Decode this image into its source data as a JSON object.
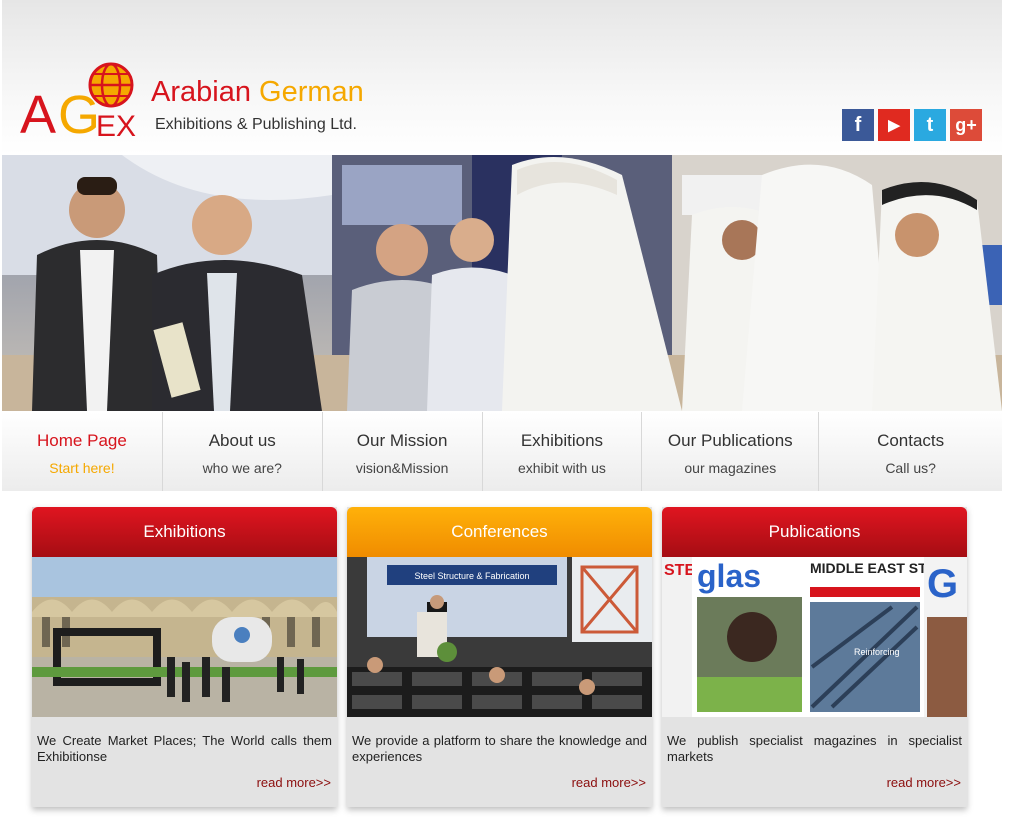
{
  "header": {
    "logo_letters": {
      "a": "A",
      "g": "G",
      "ex": "EX"
    },
    "company_name_part1": "Arabian",
    "company_name_part2": "German",
    "company_subtitle": "Exhibitions & Publishing Ltd."
  },
  "social": [
    {
      "name": "facebook-icon",
      "glyph": "f",
      "color": "#3b5998"
    },
    {
      "name": "youtube-icon",
      "glyph": "▶",
      "color": "#e02a20"
    },
    {
      "name": "twitter-icon",
      "glyph": "t",
      "color": "#2aa9e0"
    },
    {
      "name": "google-plus-icon",
      "glyph": "g+",
      "color": "#dd4b39"
    }
  ],
  "nav": [
    {
      "label": "Home Page",
      "sub": "Start here!"
    },
    {
      "label": "About us",
      "sub": "who we are?"
    },
    {
      "label": "Our Mission",
      "sub": "vision&Mission"
    },
    {
      "label": "Exhibitions",
      "sub": "exhibit with us"
    },
    {
      "label": "Our Publications",
      "sub": "our magazines"
    },
    {
      "label": "Contacts",
      "sub": "Call us?"
    }
  ],
  "cards": [
    {
      "title": "Exhibitions",
      "text": "We Create Market Places; The World calls them Exhibitionse",
      "more": "read more>>"
    },
    {
      "title": "Conferences",
      "text": "We provide a platform to share the knowledge and experiences",
      "more": "read more>>"
    },
    {
      "title": "Publications",
      "text": "We publish specialist magazines in specialist markets",
      "more": "read more>>"
    }
  ],
  "magazine_covers": {
    "steel": "STEEL",
    "glass": "glas",
    "middle_east_steel": "MIDDLE EAST STEEL",
    "reinforcing": "Reinforcing"
  },
  "conference_banner": "Steel Structure & Fabrication",
  "colors": {
    "brand_red": "#d7141d",
    "brand_orange": "#f5a800",
    "read_more": "#8b0d0d"
  }
}
